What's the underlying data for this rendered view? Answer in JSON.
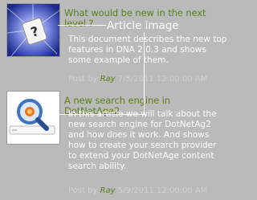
{
  "callout": {
    "label": "Article image"
  },
  "articles": [
    {
      "title": "What would be new in the next level ?",
      "description": "This document describes the new top features in DNA 2.0.3 and shows some example of them.",
      "posted_by": "Post by",
      "author": "Ray",
      "date": "7/5/2011 12:00:00 AM",
      "thumbnail_icon": "help-question-mark"
    },
    {
      "title": "A new search engine in DotNetAge2",
      "description": "In this article we will talk about the new search engine for DotNetAg2 and how does it work. And shows how to create your search provider to extend your DotNetAge content search ability.",
      "posted_by": "Post by",
      "author": "Ray",
      "date": "5/9/2011 12:00:00 AM",
      "thumbnail_icon": "search-magnifier"
    }
  ]
}
